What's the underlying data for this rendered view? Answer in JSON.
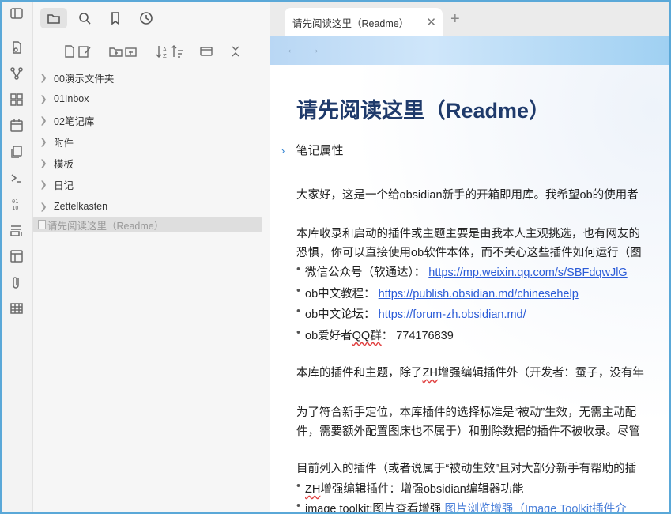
{
  "sidebar": {
    "tree": [
      {
        "label": "00演示文件夹"
      },
      {
        "label": "01Inbox"
      },
      {
        "label": "02笔记库"
      },
      {
        "label": "附件"
      },
      {
        "label": "模板"
      },
      {
        "label": "日记"
      },
      {
        "label": "Zettelkasten"
      }
    ],
    "active_file": "请先阅读这里（Readme）"
  },
  "tab": {
    "title": "请先阅读这里（Readme）",
    "close_glyph": "✕",
    "new_tab_glyph": "+"
  },
  "navigation": {
    "back_glyph": "←",
    "forward_glyph": "→"
  },
  "document": {
    "title": "请先阅读这里（Readme）",
    "properties_label": "笔记属性",
    "properties_chevron": "›",
    "p1": "大家好，这是一个给obsidian新手的开箱即用库。我希望ob的使用者",
    "p2a": "本库收录和启动的插件或主题主要是由我本人主观挑选，也有网友的",
    "p2b": "恐惧，你可以直接使用ob软件本体，而不关心这些插件如何运行（图",
    "links": [
      {
        "label": "微信公众号（软通达）：",
        "url": "https://mp.weixin.qq.com/s/SBFdqwJlG"
      },
      {
        "label": "ob中文教程：",
        "url": "https://publish.obsidian.md/chinesehelp"
      },
      {
        "label": "ob中文论坛：",
        "url": "https://forum-zh.obsidian.md/"
      }
    ],
    "qq_label_a": "ob爱好者",
    "qq_label_b": "QQ群",
    "qq_label_c": "：",
    "qq_number": "774176839",
    "p3a": "本库的插件和主题，除了",
    "p3b": "ZH",
    "p3c": "增强编辑插件外（开发者：蚕子，没有年",
    "p4a": "为了符合新手定位，本库插件的选择标准是“被动”生效，无需主动配",
    "p4b": "件，需要额外配置图床也不属于）和删除数据的插件不被收录。尽管",
    "p5": "目前列入的插件（或者说属于“被动生效”且对大部分新手有帮助的插",
    "plugin1a": "ZH",
    "plugin1b": "增强编辑插件：增强obsidian编辑器功能",
    "plugin2a": "image toolkit:图片查看增强 ",
    "plugin2b": "图片浏览增强（Image Toolkit插件介"
  }
}
